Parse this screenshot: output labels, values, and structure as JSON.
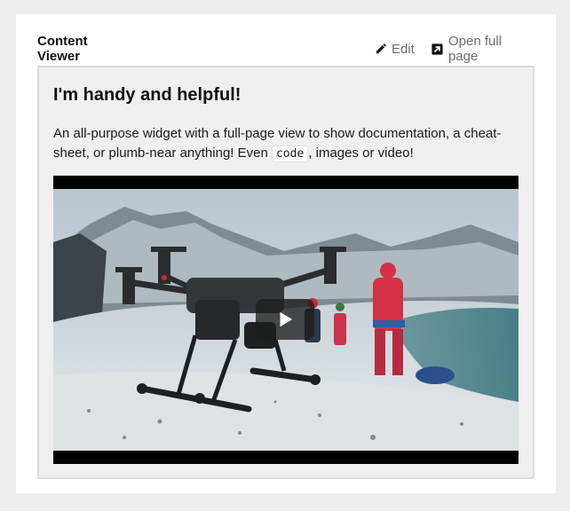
{
  "viewer": {
    "tab_title": "Content Viewer",
    "edit_label": "Edit",
    "open_label": "Open full page"
  },
  "content": {
    "heading": "I'm handy and helpful!",
    "desc_before": "An all-purpose widget with a full-page view to show documentation, a cheat-sheet, or plumb-near anything! Even ",
    "code": "code",
    "desc_after": ", images or video!"
  },
  "icons": {
    "edit": "pencil-icon",
    "open": "external-link-icon",
    "play": "play-icon"
  },
  "colors": {
    "accent": "#111111",
    "muted_text": "#6b6b6b",
    "panel_bg": "#efefef"
  }
}
